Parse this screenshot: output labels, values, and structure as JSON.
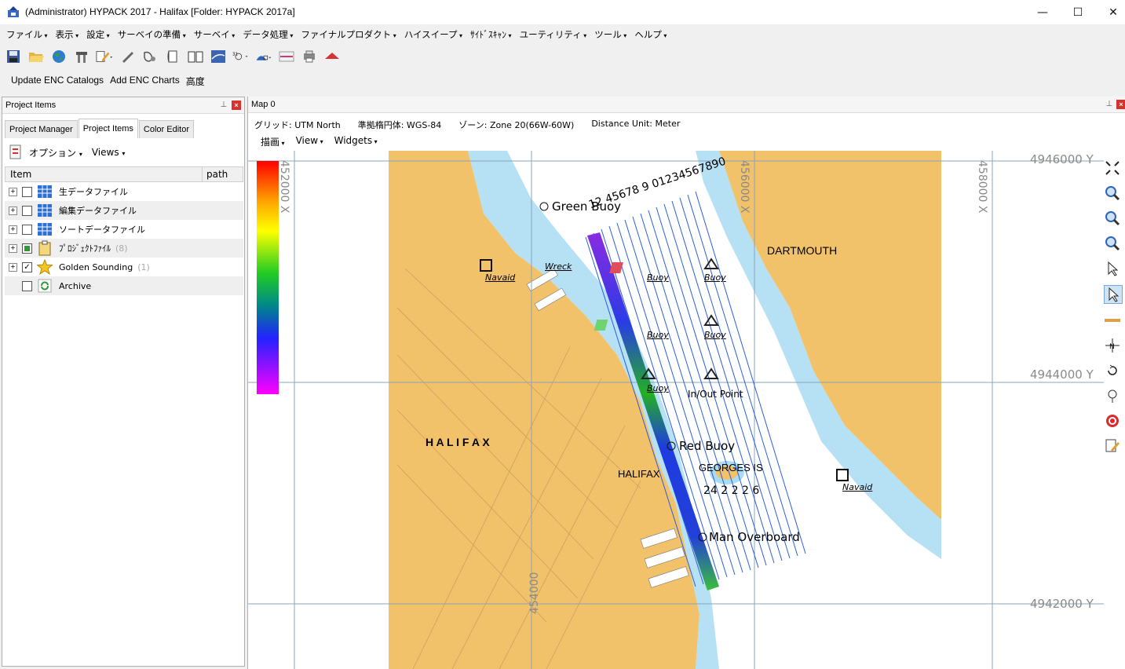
{
  "window": {
    "title": "(Administrator) HYPACK 2017 - Halifax  [Folder: HYPACK 2017a]",
    "minimize": "—",
    "maximize": "☐",
    "close": "✕"
  },
  "menubar": [
    "ファイル",
    "表示",
    "設定",
    "サーベイの準備",
    "サーベイ",
    "データ処理",
    "ファイナルプロダクト",
    "ハイスイープ",
    "ｻｲﾄﾞｽｷｬﾝ",
    "ユーティリティ",
    "ツール",
    "ヘルプ"
  ],
  "toolbar": {
    "icons": [
      "save-icon",
      "open-folder-icon",
      "globe-icon",
      "tools-icon",
      "edit-icon",
      "ruler-icon",
      "helicopter-icon",
      "page-icon",
      "book-icon",
      "flag-icon",
      "map-layers-icon",
      "sonar-icon",
      "chart-icon",
      "print-icon",
      "boat-icon"
    ]
  },
  "enc_bar": {
    "update": "Update ENC Catalogs",
    "add": "Add ENC Charts",
    "height": "高度"
  },
  "project_panel": {
    "header": "Project Items",
    "tabs": [
      "Project Manager",
      "Project Items",
      "Color Editor"
    ],
    "active_tab": 1,
    "options_label": "オプション",
    "views_label": "Views",
    "columns": [
      "Item",
      "path"
    ],
    "items": [
      {
        "label": "生データファイル",
        "count": "",
        "checked": false,
        "expander": true
      },
      {
        "label": "編集データファイル",
        "count": "",
        "checked": false,
        "expander": true
      },
      {
        "label": "ソートデータファイル",
        "count": "",
        "checked": false,
        "expander": true
      },
      {
        "label": "ﾌﾟﾛｼﾞｪｸﾄﾌｧｲﾙ",
        "count": "(8)",
        "checked": "partial",
        "expander": true
      },
      {
        "label": "Golden Sounding",
        "count": "(1)",
        "checked": true,
        "expander": true
      },
      {
        "label": "Archive",
        "count": "",
        "checked": false,
        "expander": false
      }
    ]
  },
  "map_panel": {
    "header": "Map 0",
    "grid": "グリッド: UTM North",
    "ellipsoid": "準拠楕円体: WGS-84",
    "zone": "ゾーン: Zone 20(66W-60W)",
    "distance": "Distance Unit: Meter",
    "menu": [
      "描画",
      "View",
      "Widgets"
    ],
    "grid_labels": {
      "x": [
        "452000 X",
        "454000",
        "456000 X",
        "458000 X"
      ],
      "y": [
        "4946000 Y",
        "4944000 Y",
        "4942000 Y"
      ]
    },
    "map_labels": {
      "green_buoy": "Green Buoy",
      "red_buoy": "Red Buoy",
      "man_overboard": "Man Overboard",
      "dartmouth": "DARTMOUTH",
      "halifax_big": "H A L I F A X",
      "halifax_small": "HALIFAX",
      "georges": "GEORGES IS",
      "in_out": "In/Out Point",
      "navaid": "Navaid",
      "wreck": "Wreck",
      "buoy": "Buoy",
      "line_numbers_top": "12 45678 9 01234567890",
      "line_numbers_bottom": "24 2 2 2 6"
    },
    "colors": {
      "land": "#f2c26a",
      "shallow": "#a9dcf2",
      "deep": "#ffffff",
      "survey_lines": "#2a5de0"
    }
  }
}
